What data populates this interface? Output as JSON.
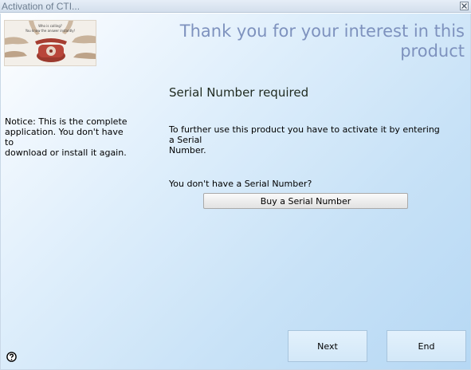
{
  "window": {
    "title": "Activation of CTI..."
  },
  "banner": {
    "line1": "Who is calling?",
    "line2": "You know the answer instantly!"
  },
  "header": {
    "headline_line1": "Thank you for your interest in this",
    "headline_line2": "product"
  },
  "sidebar": {
    "notice_line1": "Notice: This is the complete",
    "notice_line2": "application. You don't have to",
    "notice_line3": "download or install it again."
  },
  "main": {
    "heading": "Serial Number required",
    "instruction_line1": "To further use this product you have to activate it by entering a Serial",
    "instruction_line2": "Number.",
    "question": "You don't have a Serial Number?",
    "buy_label": "Buy a Serial Number"
  },
  "footer": {
    "next_label": "Next",
    "end_label": "End",
    "help_icon": "help-icon"
  },
  "colors": {
    "headline": "#7e92be",
    "background_start": "#ffffff",
    "background_end": "#b6d8f4",
    "nav_button_fill": "#d9ecfa"
  }
}
